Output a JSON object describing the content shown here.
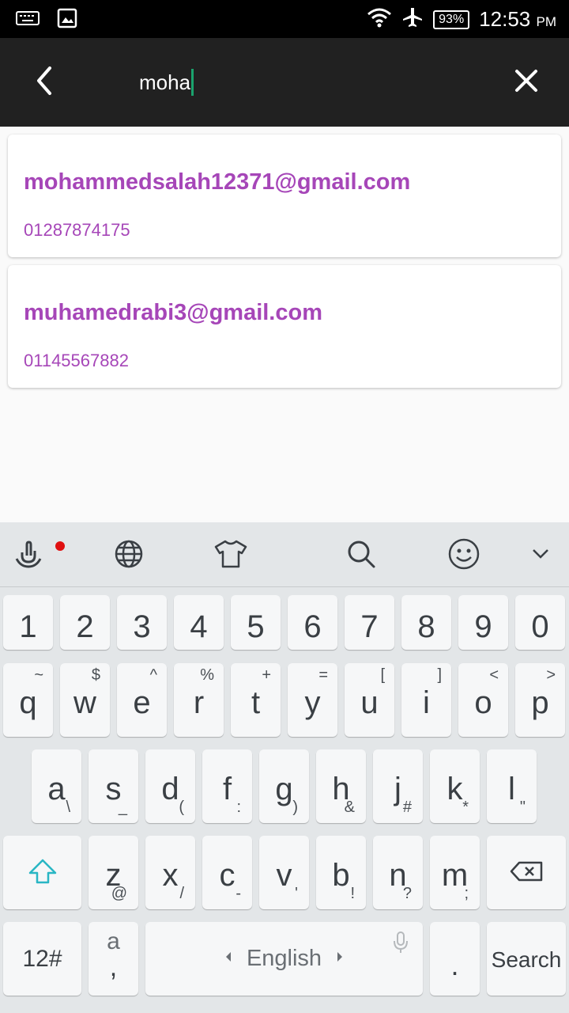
{
  "status_bar": {
    "battery": "93%",
    "time": "12:53",
    "ampm": "PM"
  },
  "search": {
    "query": "moha"
  },
  "results": [
    {
      "email": "mohammedsalah12371@gmail.com",
      "phone": "01287874175"
    },
    {
      "email": "muhamedrabi3@gmail.com",
      "phone": "01145567882"
    }
  ],
  "colors": {
    "toolbar": "#212121",
    "accent_text": "#a646b8",
    "caret": "#1aa36d"
  },
  "keyboard": {
    "digits": [
      "1",
      "2",
      "3",
      "4",
      "5",
      "6",
      "7",
      "8",
      "9",
      "0"
    ],
    "row1": [
      {
        "k": "q",
        "s": "~"
      },
      {
        "k": "w",
        "s": "$"
      },
      {
        "k": "e",
        "s": "^"
      },
      {
        "k": "r",
        "s": "%"
      },
      {
        "k": "t",
        "s": "+"
      },
      {
        "k": "y",
        "s": "="
      },
      {
        "k": "u",
        "s": "["
      },
      {
        "k": "i",
        "s": "]"
      },
      {
        "k": "o",
        "s": "<"
      },
      {
        "k": "p",
        "s": ">"
      }
    ],
    "row2": [
      {
        "k": "a",
        "s": "\\"
      },
      {
        "k": "s",
        "s": "_"
      },
      {
        "k": "d",
        "s": "("
      },
      {
        "k": "f",
        "s": ":"
      },
      {
        "k": "g",
        "s": ")"
      },
      {
        "k": "h",
        "s": "&"
      },
      {
        "k": "j",
        "s": "#"
      },
      {
        "k": "k",
        "s": "*"
      },
      {
        "k": "l",
        "s": "\""
      }
    ],
    "row3": [
      {
        "k": "z",
        "s": "@"
      },
      {
        "k": "x",
        "s": "/"
      },
      {
        "k": "c",
        "s": "-"
      },
      {
        "k": "v",
        "s": "'"
      },
      {
        "k": "b",
        "s": "!"
      },
      {
        "k": "n",
        "s": "?"
      },
      {
        "k": "m",
        "s": ";"
      }
    ],
    "symbols_label": "12#",
    "comma_top": "a",
    "comma_bottom": ",",
    "language_label": "English",
    "period_label": ".",
    "action_label": "Search"
  }
}
